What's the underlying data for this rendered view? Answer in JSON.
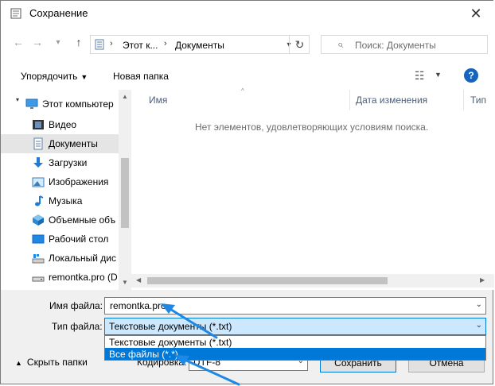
{
  "window": {
    "title": "Сохранение",
    "close_glyph": "✕"
  },
  "nav": {
    "back_glyph": "←",
    "forward_glyph": "→",
    "history_glyph": "▾",
    "up_glyph": "↑",
    "address": {
      "segments": [
        "Этот к...",
        "Документы"
      ],
      "sep": "›"
    },
    "refresh_glyph": "↻",
    "search_placeholder": "Поиск: Документы",
    "search_glyph": "⌕"
  },
  "toolbar": {
    "organize": "Упорядочить",
    "new_folder": "Новая папка",
    "view_glyph": "☷",
    "help": "?"
  },
  "sidebar": {
    "items": [
      {
        "label": "Этот компьютер",
        "icon": "computer-icon",
        "selected": false
      },
      {
        "label": "Видео",
        "icon": "video-icon",
        "selected": false
      },
      {
        "label": "Документы",
        "icon": "documents-icon",
        "selected": true
      },
      {
        "label": "Загрузки",
        "icon": "downloads-icon",
        "selected": false
      },
      {
        "label": "Изображения",
        "icon": "pictures-icon",
        "selected": false
      },
      {
        "label": "Музыка",
        "icon": "music-icon",
        "selected": false
      },
      {
        "label": "Объемные объ",
        "icon": "3d-objects-icon",
        "selected": false
      },
      {
        "label": "Рабочий стол",
        "icon": "desktop-icon",
        "selected": false
      },
      {
        "label": "Локальный дис",
        "icon": "local-disk-icon",
        "selected": false
      },
      {
        "label": "remontka.pro (D",
        "icon": "drive-icon",
        "selected": false
      }
    ]
  },
  "filelist": {
    "columns": [
      "Имя",
      "Дата изменения",
      "Тип"
    ],
    "empty_message": "Нет элементов, удовлетворяющих условиям поиска."
  },
  "form": {
    "filename_label": "Имя файла:",
    "filename_value": "remontka.pro",
    "filetype_label": "Тип файла:",
    "filetype_value": "Текстовые документы (*.txt)",
    "filetype_options": [
      "Текстовые документы (*.txt)",
      "Все файлы  (*.*)"
    ],
    "filetype_highlighted_index": 1
  },
  "bottom": {
    "hide_folders": "Скрыть папки",
    "encoding_label": "Кодировка:",
    "encoding_value": "UTF-8",
    "save": "Сохранить",
    "cancel": "Отмена"
  },
  "colors": {
    "accent": "#0078d7",
    "annotation_arrow": "#1e88e5",
    "selection_bg": "#cce8ff"
  }
}
